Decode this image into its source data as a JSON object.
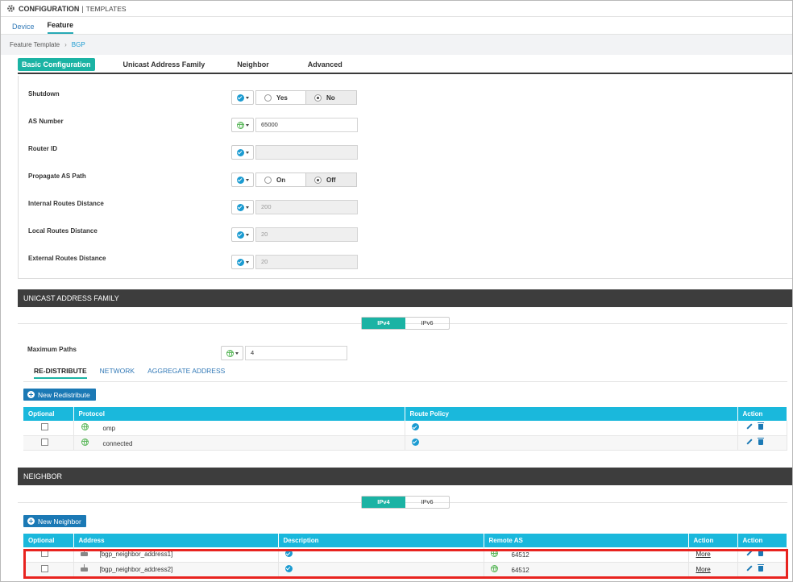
{
  "header": {
    "title": "CONFIGURATION",
    "separator": "|",
    "section": "TEMPLATES"
  },
  "top_tabs": [
    {
      "label": "Device",
      "active": false
    },
    {
      "label": "Feature",
      "active": true
    }
  ],
  "breadcrumb": {
    "parent": "Feature Template",
    "arrow": "›",
    "current": "BGP"
  },
  "sub_tabs": [
    {
      "label": "Basic Configuration",
      "active": true
    },
    {
      "label": "Unicast Address Family",
      "active": false
    },
    {
      "label": "Neighbor",
      "active": false
    },
    {
      "label": "Advanced",
      "active": false
    }
  ],
  "basic": {
    "shutdown": {
      "label": "Shutdown",
      "scope_icon": "check-icon",
      "options": [
        "Yes",
        "No"
      ],
      "selected": "No"
    },
    "as_number": {
      "label": "AS Number",
      "scope_icon": "globe-icon",
      "value": "65000"
    },
    "router_id": {
      "label": "Router ID",
      "scope_icon": "check-icon",
      "value": ""
    },
    "propagate": {
      "label": "Propagate AS Path",
      "scope_icon": "check-icon",
      "options": [
        "On",
        "Off"
      ],
      "selected": "Off"
    },
    "internal_distance": {
      "label": "Internal Routes Distance",
      "scope_icon": "check-icon",
      "value": "200"
    },
    "local_distance": {
      "label": "Local Routes Distance",
      "scope_icon": "check-icon",
      "value": "20"
    },
    "external_distance": {
      "label": "External Routes Distance",
      "scope_icon": "check-icon",
      "value": "20"
    }
  },
  "unicast": {
    "title": "UNICAST ADDRESS FAMILY",
    "ip_tabs": [
      "IPv4",
      "IPv6"
    ],
    "max_paths": {
      "label": "Maximum Paths",
      "scope_icon": "globe-icon",
      "value": "4"
    },
    "tabs": [
      "RE-DISTRIBUTE",
      "NETWORK",
      "AGGREGATE ADDRESS"
    ],
    "new_button": "New Redistribute",
    "columns": [
      "Optional",
      "Protocol",
      "Route Policy",
      "Action"
    ],
    "rows": [
      {
        "protocol": "omp"
      },
      {
        "protocol": "connected"
      }
    ]
  },
  "neighbor": {
    "title": "NEIGHBOR",
    "ip_tabs": [
      "IPv4",
      "IPv6"
    ],
    "new_button": "New Neighbor",
    "columns": [
      "Optional",
      "Address",
      "Description",
      "Remote AS",
      "Action",
      "Action"
    ],
    "rows": [
      {
        "address": "[bgp_neighbor_address1]",
        "remote_as": "64512",
        "more": "More"
      },
      {
        "address": "[bgp_neighbor_address2]",
        "remote_as": "64512",
        "more": "More"
      }
    ]
  },
  "colors": {
    "accent": "#1bb3a4",
    "table_header": "#1ab8dc",
    "section_header": "#3d3d3d",
    "button": "#1b79b5",
    "highlight": "#e8231f"
  }
}
